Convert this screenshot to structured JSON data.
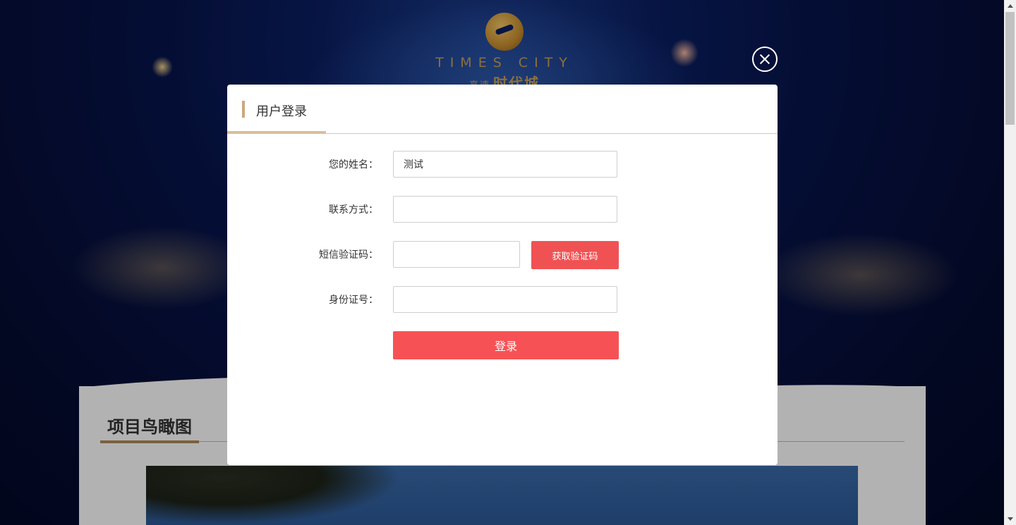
{
  "logo": {
    "en": "TIMES CITY",
    "cn_small": "高速",
    "cn": "时代城"
  },
  "section": {
    "title": "项目鸟瞰图"
  },
  "modal": {
    "title": "用户登录",
    "fields": {
      "name": {
        "label": "您的姓名：",
        "value": "测试",
        "placeholder": ""
      },
      "contact": {
        "label": "联系方式：",
        "value": "",
        "placeholder": ""
      },
      "sms": {
        "label": "短信验证码：",
        "value": "",
        "placeholder": ""
      },
      "id_number": {
        "label": "身份证号：",
        "value": "",
        "placeholder": ""
      }
    },
    "get_code_label": "获取验证码",
    "login_label": "登录"
  },
  "colors": {
    "accent_red": "#f65255",
    "accent_gold": "#c9a97f",
    "bg_navy": "#07144a"
  }
}
